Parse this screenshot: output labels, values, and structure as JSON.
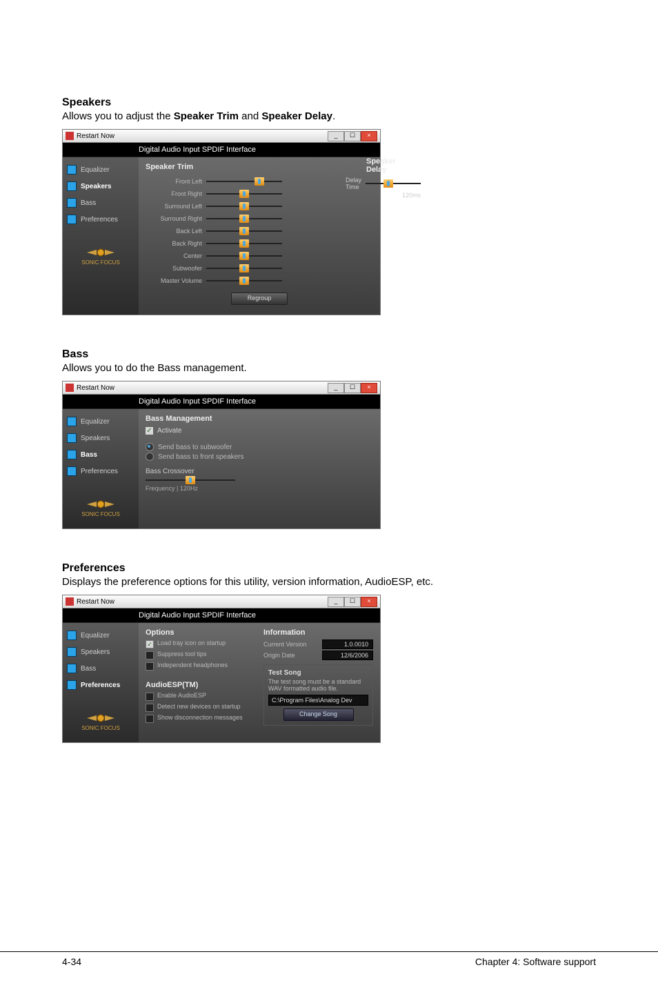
{
  "footer": {
    "left": "4-34",
    "right": "Chapter 4: Software support"
  },
  "speakers": {
    "heading": "Speakers",
    "desc_pre": "Allows you to adjust the ",
    "desc_b1": "Speaker Trim",
    "desc_mid": " and ",
    "desc_b2": "Speaker Delay",
    "desc_post": ".",
    "window_title": "Restart Now",
    "banner": "Digital Audio Input SPDIF Interface",
    "tabs": [
      "Equalizer",
      "Speakers",
      "Bass",
      "Preferences"
    ],
    "logo": "SONIC FOCUS",
    "trim_heading": "Speaker Trim",
    "delay_heading": "Speaker Delay",
    "trims": [
      "Front Left",
      "Front Right",
      "Surround Left",
      "Surround Right",
      "Back Left",
      "Back Right",
      "Center",
      "Subwoofer",
      "Master Volume"
    ],
    "delay_label": "Delay Time",
    "delay_value": "120ms",
    "regroup": "Regroup"
  },
  "bass": {
    "heading": "Bass",
    "desc": "Allows you to do the Bass management.",
    "window_title": "Restart Now",
    "banner": "Digital Audio Input SPDIF Interface",
    "tabs": [
      "Equalizer",
      "Speakers",
      "Bass",
      "Preferences"
    ],
    "logo": "SONIC FOCUS",
    "section_heading": "Bass Management",
    "activate": "Activate",
    "opt1": "Send bass to subwoofer",
    "opt2": "Send bass to front speakers",
    "crossover_label": "Bass Crossover",
    "freq_label": "Frequency   | 120Hz"
  },
  "prefs": {
    "heading": "Preferences",
    "desc": "Displays the preference options for this utility, version information, AudioESP, etc.",
    "window_title": "Restart Now",
    "banner": "Digital Audio Input SPDIF Interface",
    "tabs": [
      "Equalizer",
      "Speakers",
      "Bass",
      "Preferences"
    ],
    "logo": "SONIC FOCUS",
    "options_heading": "Options",
    "opt_tray": "Load tray icon on startup",
    "opt_suppress": "Suppress tool tips",
    "opt_indep": "Independent headphones",
    "audioesp_heading": "AudioESP(TM)",
    "esp_enable": "Enable AudioESP",
    "esp_detect": "Detect new devices on startup",
    "esp_show": "Show disconnection messages",
    "info_heading": "Information",
    "ver_label": "Current Version",
    "ver_value": "1.0.0010",
    "date_label": "Origin Date",
    "date_value": "12/6/2006",
    "test_heading": "Test Song",
    "test_note": "The test song must be a standard WAV formatted audio file.",
    "test_path": "C:\\Program Files\\Analog Dev",
    "change_song": "Change Song"
  }
}
